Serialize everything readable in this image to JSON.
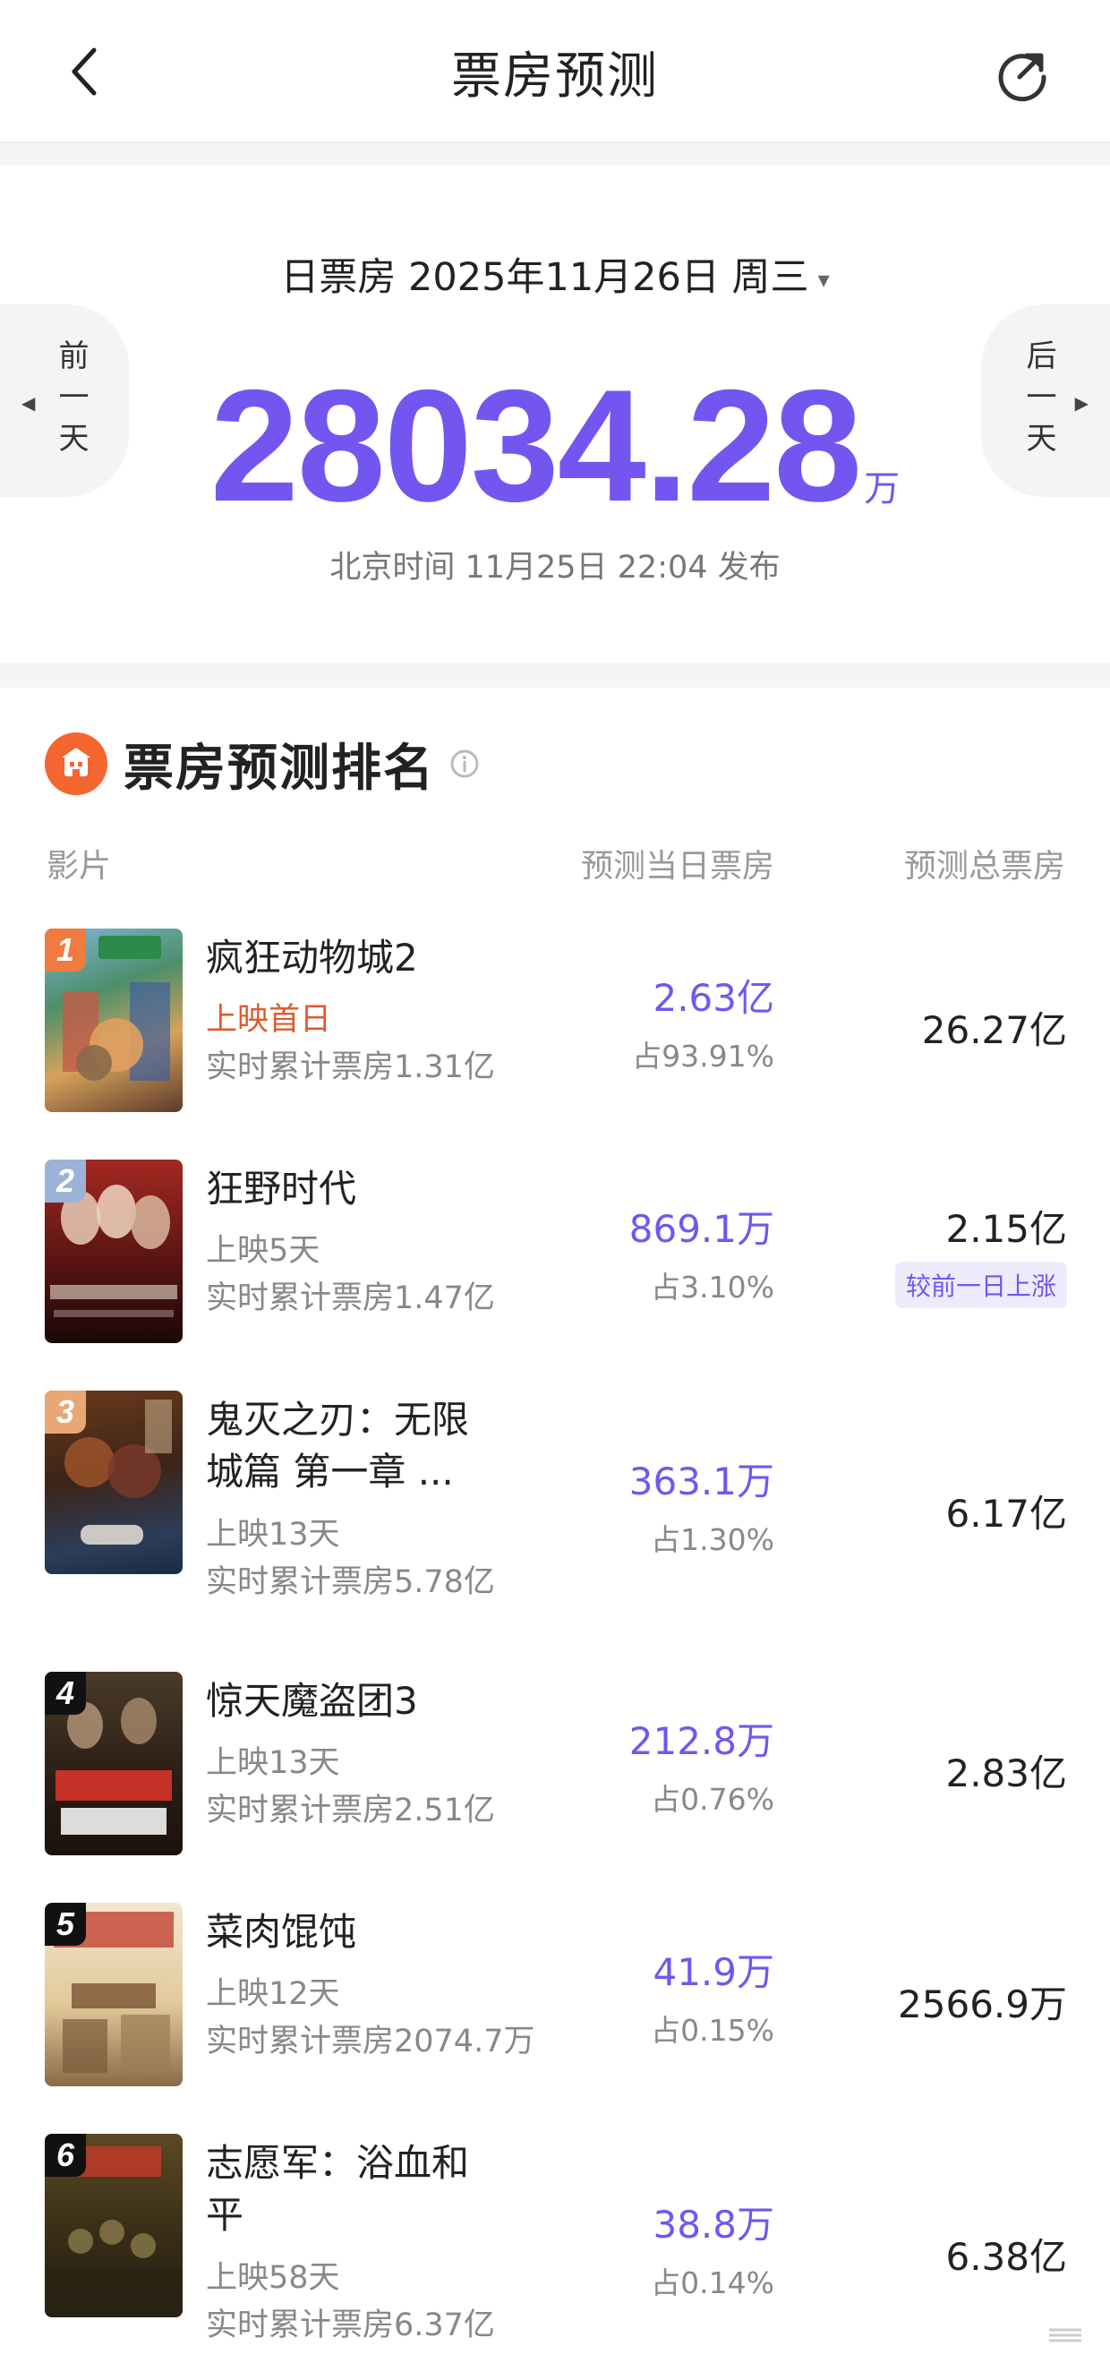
{
  "header": {
    "title": "票房预测",
    "back_icon": "chevron-left-icon",
    "share_icon": "share-refresh-icon"
  },
  "date_section": {
    "date_label": "日票房 2025年11月26日 周三",
    "caret": "▾",
    "total_value": "28034.28",
    "total_unit": "万",
    "publish_time": "北京时间 11月25日 22:04 发布",
    "prev_day_label": "前一天",
    "next_day_label": "后一天"
  },
  "ranking": {
    "title": "票房预测排名",
    "columns": {
      "film": "影片",
      "daily": "预测当日票房",
      "total": "预测总票房"
    },
    "movies": [
      {
        "rank": "1",
        "name_line1": "疯狂动物城2",
        "name_line2": "",
        "status": "上映首日",
        "cumulative": "实时累计票房1.31亿",
        "daily": "2.63亿",
        "share": "占93.91%",
        "total": "26.27亿",
        "badge": ""
      },
      {
        "rank": "2",
        "name_line1": "狂野时代",
        "name_line2": "",
        "status": "上映5天",
        "cumulative": "实时累计票房1.47亿",
        "daily": "869.1万",
        "share": "占3.10%",
        "total": "2.15亿",
        "badge": "较前一日上涨"
      },
      {
        "rank": "3",
        "name_line1": "鬼灭之刃：无限",
        "name_line2": "城篇 第一章 ...",
        "status": "上映13天",
        "cumulative": "实时累计票房5.78亿",
        "daily": "363.1万",
        "share": "占1.30%",
        "total": "6.17亿",
        "badge": ""
      },
      {
        "rank": "4",
        "name_line1": "惊天魔盗团3",
        "name_line2": "",
        "status": "上映13天",
        "cumulative": "实时累计票房2.51亿",
        "daily": "212.8万",
        "share": "占0.76%",
        "total": "2.83亿",
        "badge": ""
      },
      {
        "rank": "5",
        "name_line1": "菜肉馄饨",
        "name_line2": "",
        "status": "上映12天",
        "cumulative": "实时累计票房2074.7万",
        "daily": "41.9万",
        "share": "占0.15%",
        "total": "2566.9万",
        "badge": ""
      },
      {
        "rank": "6",
        "name_line1": "志愿军：浴血和",
        "name_line2": "平",
        "status": "上映58天",
        "cumulative": "实时累计票房6.37亿",
        "daily": "38.8万",
        "share": "占0.14%",
        "total": "6.38亿",
        "badge": ""
      }
    ]
  },
  "colors": {
    "accent": "#7356f0",
    "highlight": "#e05a2e",
    "logo": "#f4652f"
  }
}
